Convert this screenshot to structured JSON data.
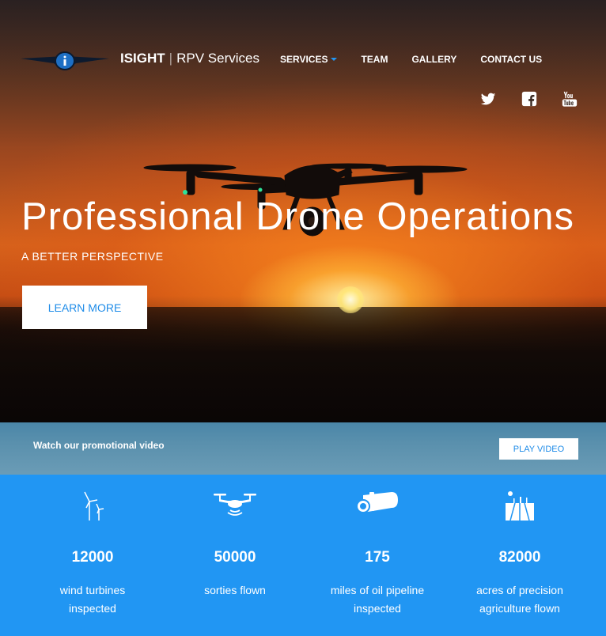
{
  "brand": {
    "name": "ISIGHT",
    "separator": "|",
    "tagline": "RPV Services"
  },
  "nav": {
    "items": [
      "SERVICES",
      "TEAM",
      "GALLERY",
      "CONTACT US"
    ]
  },
  "social": [
    "twitter-icon",
    "facebook-icon",
    "youtube-icon"
  ],
  "hero": {
    "headline": "Professional Drone Operations",
    "subheadline": "A BETTER PERSPECTIVE",
    "cta_label": "LEARN MORE"
  },
  "video": {
    "label": "Watch our promotional video",
    "button_label": "PLAY VIDEO"
  },
  "stats": [
    {
      "value": "12000",
      "label": "wind turbines inspected",
      "icon": "wind-turbine-icon"
    },
    {
      "value": "50000",
      "label": "sorties flown",
      "icon": "drone-icon"
    },
    {
      "value": "175",
      "label": "miles of oil pipeline inspected",
      "icon": "pipeline-icon"
    },
    {
      "value": "82000",
      "label": "acres of precision agriculture flown",
      "icon": "agriculture-field-icon"
    }
  ],
  "colors": {
    "accent": "#2196f3",
    "button_text": "#1f8ce8"
  }
}
